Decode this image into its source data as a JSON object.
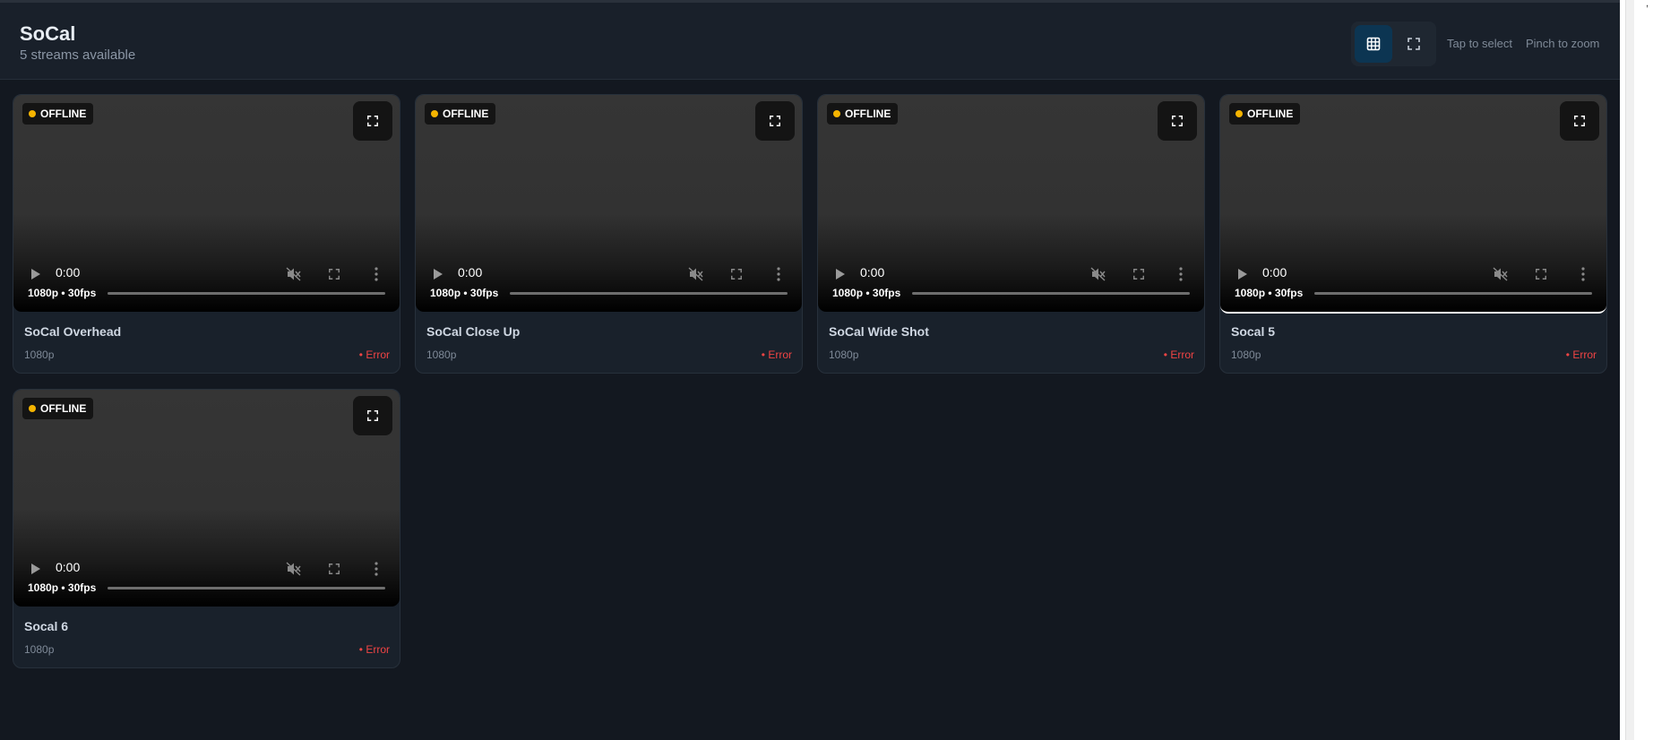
{
  "header": {
    "title": "SoCal",
    "subtitle": "5 streams available",
    "hint_select": "Tap to select",
    "hint_zoom": "Pinch to zoom"
  },
  "view_toggle": {
    "active": "grid",
    "grid_icon": "grid-icon",
    "fullscreen_icon": "expand-icon"
  },
  "colors": {
    "offline_dot": "#f5b400",
    "error": "#f04444",
    "active_toggle": "#0c3552"
  },
  "streams": [
    {
      "badge": "OFFLINE",
      "time": "0:00",
      "res_label": "1080p • 30fps",
      "name": "SoCal Overhead",
      "resolution": "1080p",
      "status": "• Error",
      "progress": 0,
      "selected": false
    },
    {
      "badge": "OFFLINE",
      "time": "0:00",
      "res_label": "1080p • 30fps",
      "name": "SoCal Close Up",
      "resolution": "1080p",
      "status": "• Error",
      "progress": 0,
      "selected": false
    },
    {
      "badge": "OFFLINE",
      "time": "0:00",
      "res_label": "1080p • 30fps",
      "name": "SoCal Wide Shot",
      "resolution": "1080p",
      "status": "• Error",
      "progress": 0,
      "selected": false
    },
    {
      "badge": "OFFLINE",
      "time": "0:00",
      "res_label": "1080p • 30fps",
      "name": "Socal 5",
      "resolution": "1080p",
      "status": "• Error",
      "progress": 0,
      "selected": true
    },
    {
      "badge": "OFFLINE",
      "time": "0:00",
      "res_label": "1080p • 30fps",
      "name": "Socal 6",
      "resolution": "1080p",
      "status": "• Error",
      "progress": 0,
      "selected": false
    }
  ]
}
